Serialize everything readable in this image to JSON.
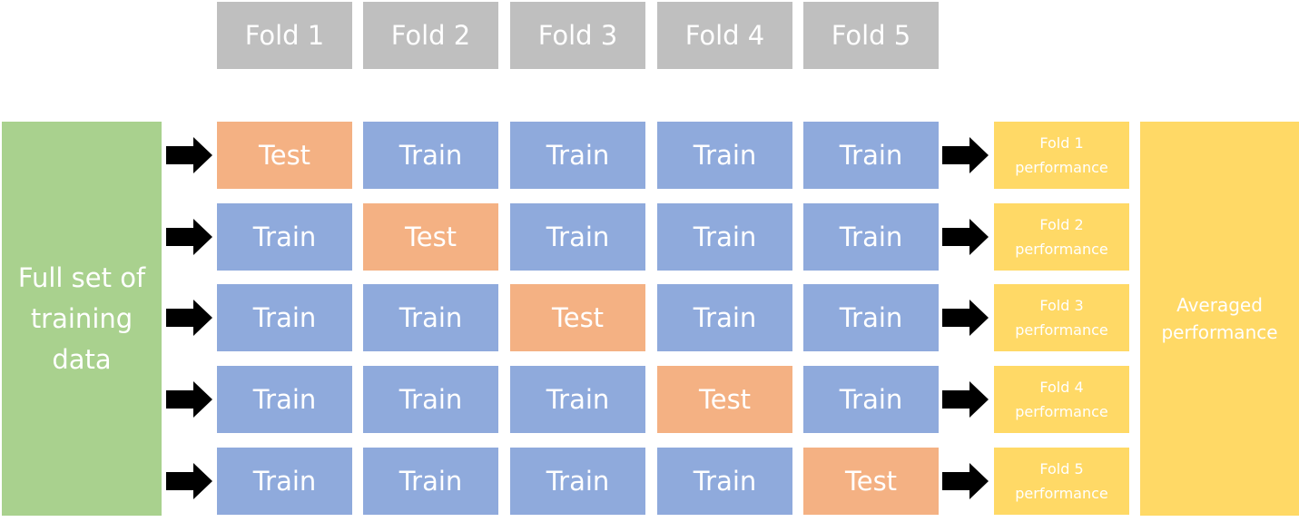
{
  "folds": [
    "Fold 1",
    "Fold 2",
    "Fold 3",
    "Fold 4",
    "Fold 5"
  ],
  "full_set_label": "Full set of training data",
  "rows": [
    {
      "cells": [
        "Test",
        "Train",
        "Train",
        "Train",
        "Train"
      ],
      "performance": "Fold 1 performance"
    },
    {
      "cells": [
        "Train",
        "Test",
        "Train",
        "Train",
        "Train"
      ],
      "performance": "Fold 2 performance"
    },
    {
      "cells": [
        "Train",
        "Train",
        "Test",
        "Train",
        "Train"
      ],
      "performance": "Fold 3 performance"
    },
    {
      "cells": [
        "Train",
        "Train",
        "Train",
        "Test",
        "Train"
      ],
      "performance": "Fold 4 performance"
    },
    {
      "cells": [
        "Train",
        "Train",
        "Train",
        "Train",
        "Test"
      ],
      "performance": "Fold 5 performance"
    }
  ],
  "averaged_label": "Averaged performance",
  "colors": {
    "header": "#bfbfbf",
    "test": "#f4b183",
    "train": "#8faadc",
    "full_set": "#a9d18e",
    "performance": "#ffd966"
  }
}
